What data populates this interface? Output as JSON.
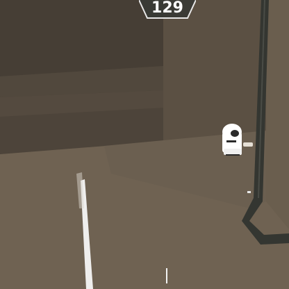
{
  "hud": {
    "counter": "129"
  },
  "colors": {
    "floor": "#6f6252",
    "wall_back": "#5a4f42",
    "wall_left": "#4f463b",
    "frame": "#363833",
    "character": "#ffffff",
    "hud_text": "#ffffff"
  }
}
